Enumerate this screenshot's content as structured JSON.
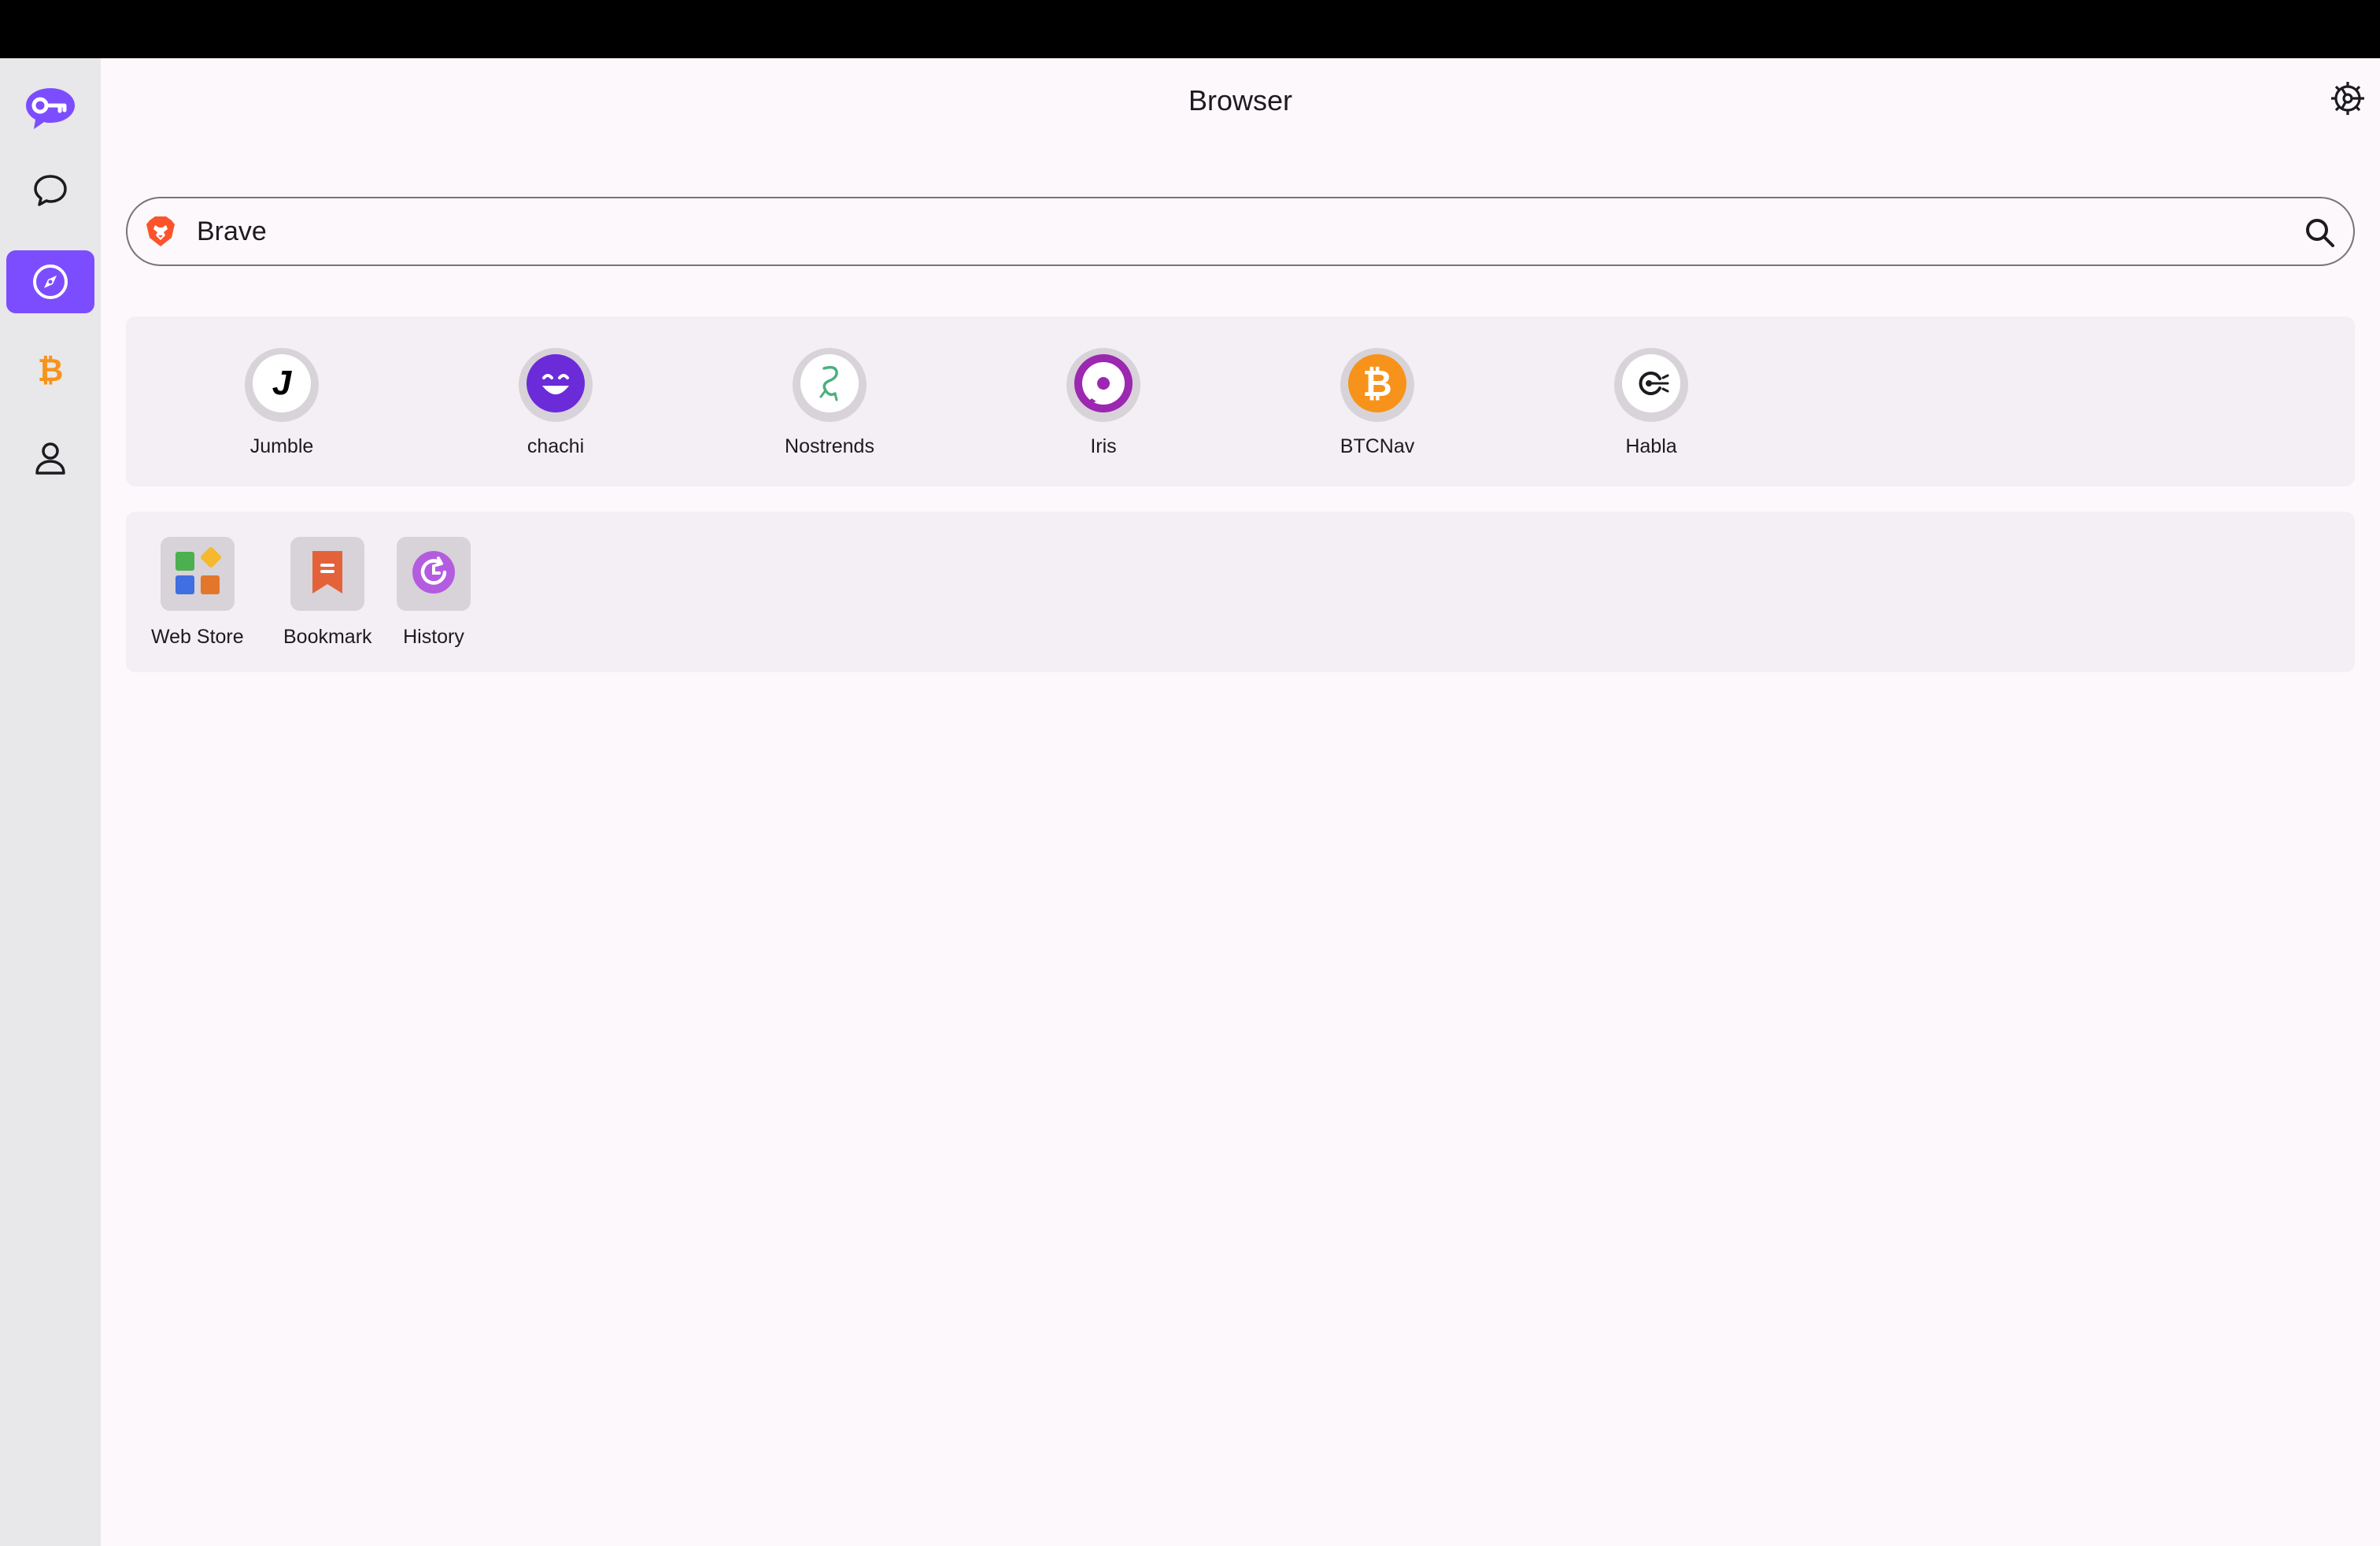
{
  "window": {
    "title": "Browser"
  },
  "colors": {
    "accent": "#7c4dff",
    "bitcoin": "#f7931a",
    "background": "#fdf8fc",
    "panel": "#f3eff4"
  },
  "sidebar": {
    "items": [
      {
        "icon": "key-chat-logo-icon",
        "active": false
      },
      {
        "icon": "chat-bubble-icon",
        "active": false
      },
      {
        "icon": "compass-icon",
        "active": true
      },
      {
        "icon": "bitcoin-icon",
        "active": false
      },
      {
        "icon": "person-icon",
        "active": false
      }
    ]
  },
  "header": {
    "settings_icon": "gear-icon"
  },
  "search": {
    "engine_icon": "brave-lion-icon",
    "value": "Brave",
    "search_icon": "search-icon"
  },
  "apps": [
    {
      "label": "Jumble",
      "icon": "jumble-icon"
    },
    {
      "label": "chachi",
      "icon": "chachi-smiley-icon"
    },
    {
      "label": "Nostrends",
      "icon": "nostrends-icon"
    },
    {
      "label": "Iris",
      "icon": "iris-icon"
    },
    {
      "label": "BTCNav",
      "icon": "bitcoin-icon"
    },
    {
      "label": "Habla",
      "icon": "habla-icon"
    }
  ],
  "tools": [
    {
      "label": "Web Store",
      "icon": "web-store-icon"
    },
    {
      "label": "Bookmark",
      "icon": "bookmark-icon"
    },
    {
      "label": "History",
      "icon": "history-icon"
    }
  ]
}
